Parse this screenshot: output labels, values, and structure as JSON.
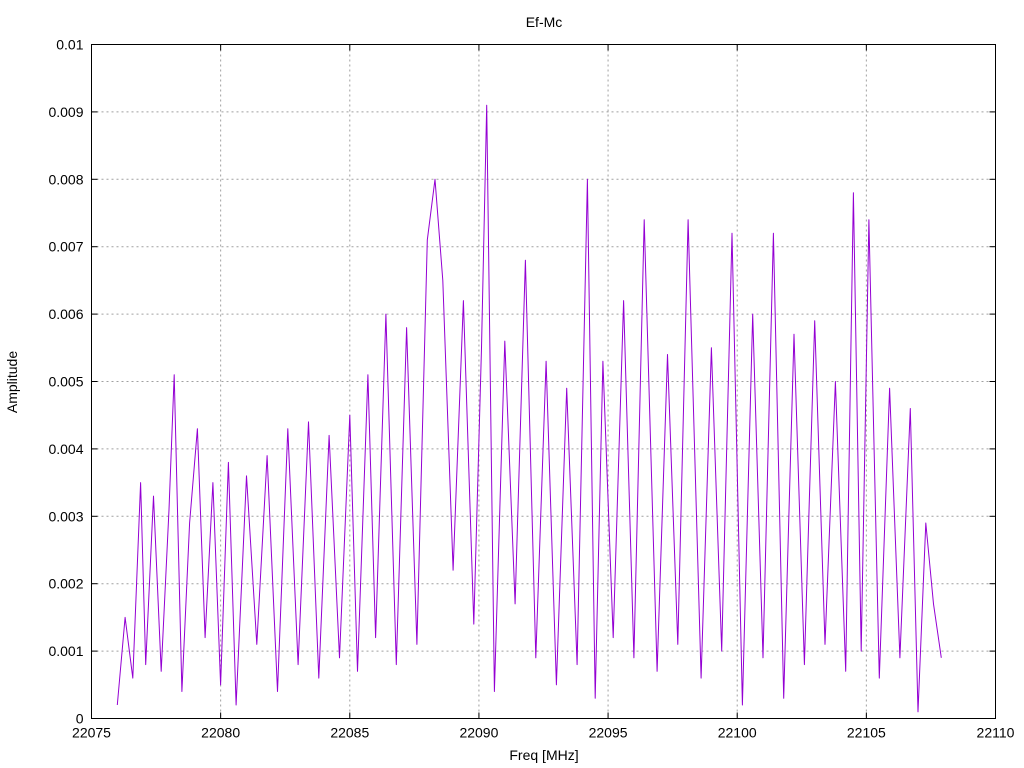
{
  "chart_data": {
    "type": "line",
    "title": "Ef-Mc",
    "xlabel": "Freq [MHz]",
    "ylabel": "Amplitude",
    "xlim": [
      22075,
      22110
    ],
    "ylim": [
      0,
      0.01
    ],
    "x_ticks": [
      "22075",
      "22080",
      "22085",
      "22090",
      "22095",
      "22100",
      "22105",
      "22110"
    ],
    "y_ticks": [
      "0",
      "0.001",
      "0.002",
      "0.003",
      "0.004",
      "0.005",
      "0.006",
      "0.007",
      "0.008",
      "0.009",
      "0.01"
    ],
    "grid": true,
    "legend": "none",
    "series_color": "#9400d3",
    "series": [
      {
        "x": [
          22076.0,
          22076.3,
          22076.6,
          22076.9,
          22077.1,
          22077.4,
          22077.7,
          22078.0,
          22078.2,
          22078.5,
          22078.8,
          22079.1,
          22079.4,
          22079.7,
          22080.0,
          22080.3,
          22080.6,
          22081.0,
          22081.4,
          22081.8,
          22082.2,
          22082.6,
          22083.0,
          22083.4,
          22083.8,
          22084.2,
          22084.6,
          22085.0,
          22085.3,
          22085.7,
          22086.0,
          22086.4,
          22086.8,
          22087.2,
          22087.6,
          22088.0,
          22088.3,
          22088.6,
          22089.0,
          22089.4,
          22089.8,
          22090.1,
          22090.3,
          22090.6,
          22091.0,
          22091.4,
          22091.8,
          22092.2,
          22092.6,
          22093.0,
          22093.4,
          22093.8,
          22094.2,
          22094.5,
          22094.8,
          22095.2,
          22095.6,
          22096.0,
          22096.4,
          22096.9,
          22097.3,
          22097.7,
          22098.1,
          22098.6,
          22099.0,
          22099.4,
          22099.8,
          22100.2,
          22100.6,
          22101.0,
          22101.4,
          22101.8,
          22102.2,
          22102.6,
          22103.0,
          22103.4,
          22103.8,
          22104.2,
          22104.5,
          22104.8,
          22105.1,
          22105.5,
          22105.9,
          22106.3,
          22106.7,
          22107.0,
          22107.3,
          22107.6,
          22107.9
        ],
        "y": [
          0.0002,
          0.0015,
          0.0006,
          0.0035,
          0.0008,
          0.0033,
          0.0007,
          0.0031,
          0.0051,
          0.0004,
          0.0029,
          0.0043,
          0.0012,
          0.0035,
          0.0005,
          0.0038,
          0.0002,
          0.0036,
          0.0011,
          0.0039,
          0.0004,
          0.0043,
          0.0008,
          0.0044,
          0.0006,
          0.0042,
          0.0009,
          0.0045,
          0.0007,
          0.0051,
          0.0012,
          0.006,
          0.0008,
          0.0058,
          0.0011,
          0.0071,
          0.008,
          0.0065,
          0.0022,
          0.0062,
          0.0014,
          0.0055,
          0.0091,
          0.0004,
          0.0056,
          0.0017,
          0.0068,
          0.0009,
          0.0053,
          0.0005,
          0.0049,
          0.0008,
          0.008,
          0.0003,
          0.0053,
          0.0012,
          0.0062,
          0.0009,
          0.0074,
          0.0007,
          0.0054,
          0.0011,
          0.0074,
          0.0006,
          0.0055,
          0.001,
          0.0072,
          0.0002,
          0.006,
          0.0009,
          0.0072,
          0.0003,
          0.0057,
          0.0008,
          0.0059,
          0.0011,
          0.005,
          0.0007,
          0.0078,
          0.001,
          0.0074,
          0.0006,
          0.0049,
          0.0009,
          0.0046,
          0.0001,
          0.0029,
          0.0017,
          0.0009
        ]
      }
    ]
  }
}
